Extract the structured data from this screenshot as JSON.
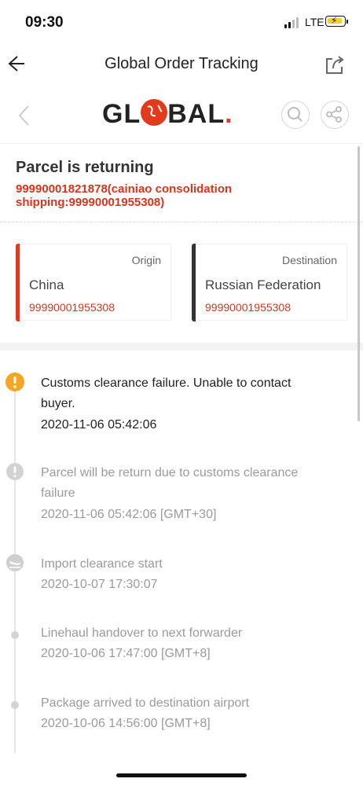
{
  "status_bar": {
    "time": "09:30",
    "network": "LTE"
  },
  "nav": {
    "title": "Global Order Tracking"
  },
  "brand": {
    "logo_left": "GL",
    "logo_right": "BAL",
    "logo_dot": "."
  },
  "parcel": {
    "status_title": "Parcel is returning",
    "tracking_text": "99990001821878(cainiao consolidation shipping:99990001955308)"
  },
  "origin": {
    "label": "Origin",
    "country": "China",
    "code": "99990001955308"
  },
  "destination": {
    "label": "Destination",
    "country": "Russian Federation",
    "code": "99990001955308"
  },
  "events": [
    {
      "desc": "Customs clearance failure. Unable to contact buyer.",
      "time": "2020-11-06 05:42:06",
      "icon": "warning-icon",
      "active": true
    },
    {
      "desc": "Parcel will be return due to customs clearance failure",
      "time": "2020-11-06 05:42:06 [GMT+30]",
      "icon": "info-icon"
    },
    {
      "desc": "Import clearance start",
      "time": "2020-10-07 17:30:07",
      "icon": "airplane-landing-icon"
    },
    {
      "desc": "Linehaul handover to next forwarder",
      "time": "2020-10-06 17:47:00 [GMT+8]",
      "icon": "dot-icon"
    },
    {
      "desc": "Package arrived to destination airport",
      "time": "2020-10-06 14:56:00 [GMT+8]",
      "icon": "dot-icon"
    }
  ],
  "colors": {
    "accent": "#d9341c",
    "warning": "#f5a623",
    "muted": "#9b9b9b",
    "origin_bar": "#e23a1b",
    "destination_bar": "#333333"
  }
}
